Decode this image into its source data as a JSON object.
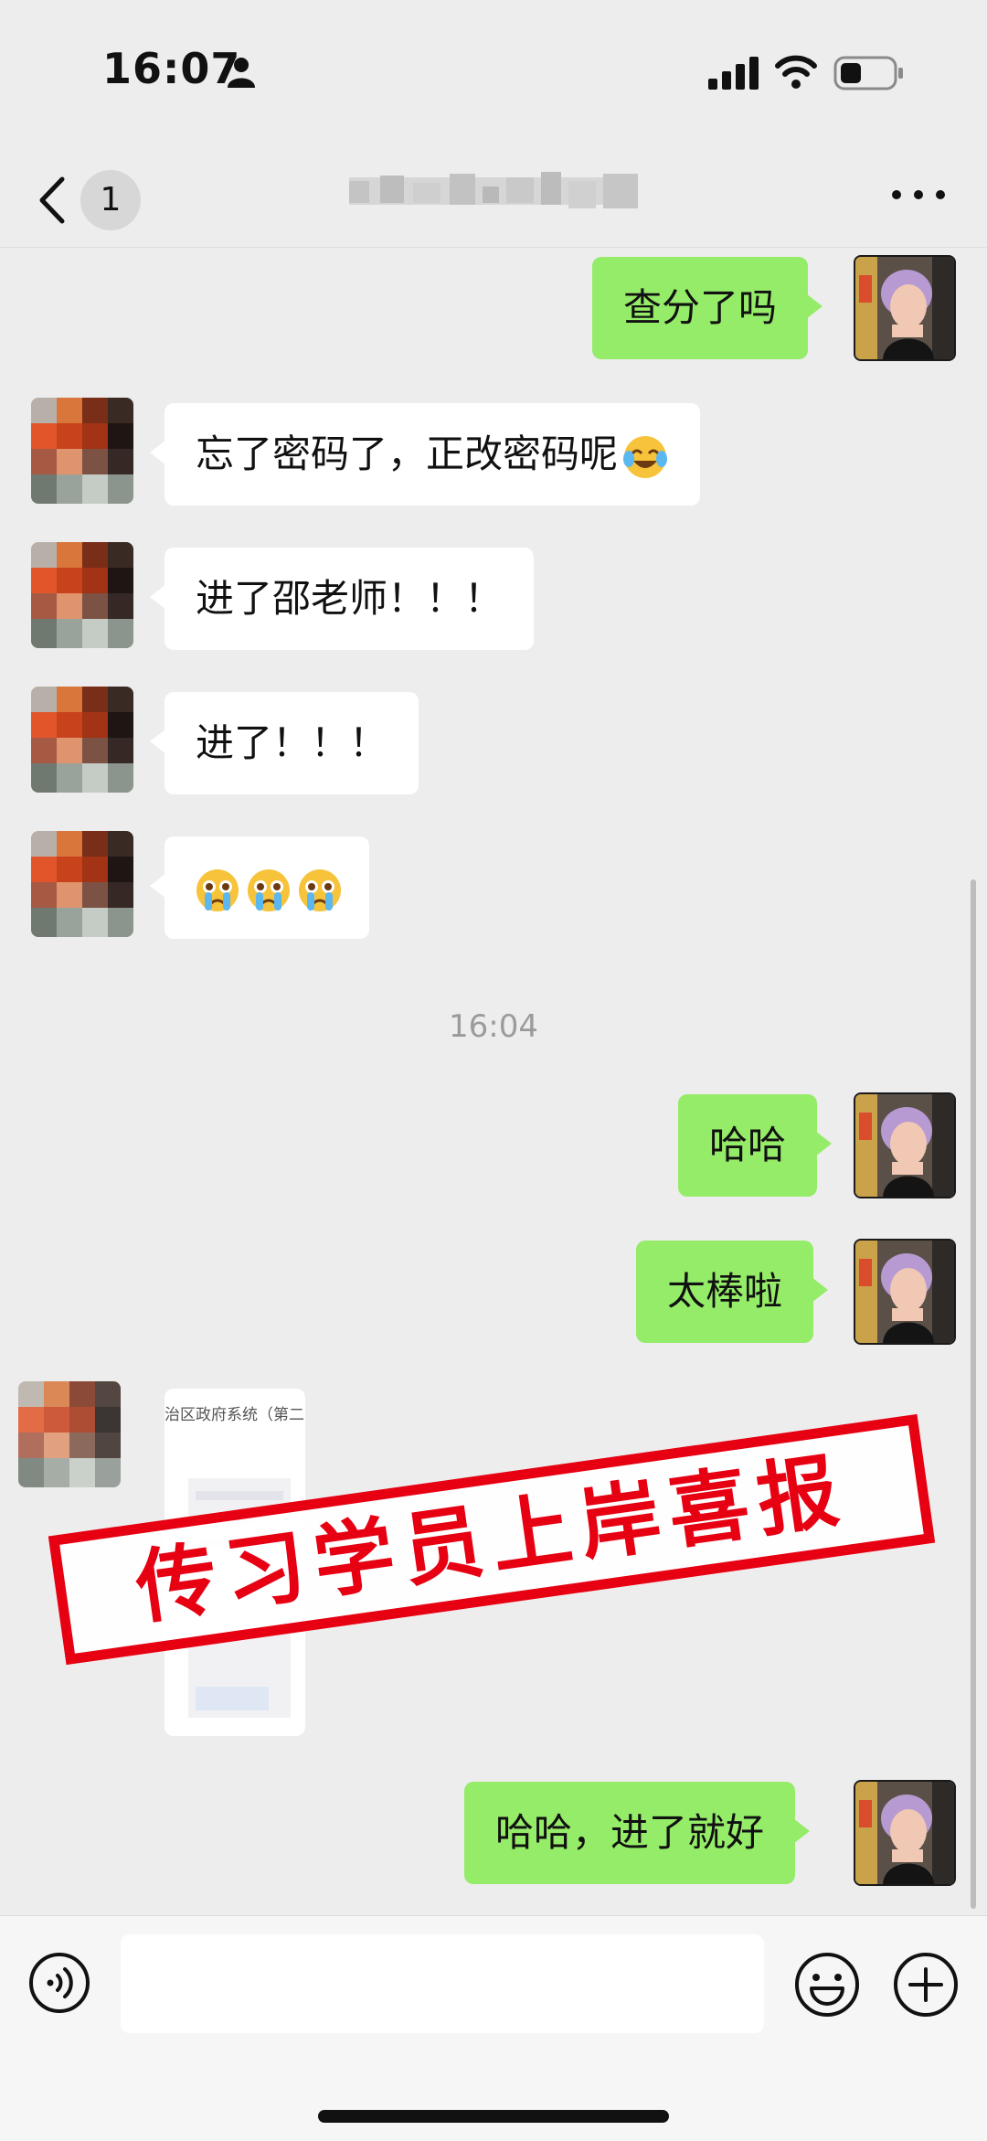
{
  "status_bar": {
    "time": "16:07"
  },
  "nav": {
    "unread_count": "1",
    "more_label": "···"
  },
  "messages": [
    {
      "side": "out",
      "text": "查分了吗"
    },
    {
      "side": "in",
      "text": "忘了密码了，正改密码呢",
      "emoji": "face-with-tears-of-joy"
    },
    {
      "side": "in",
      "text": "进了邵老师！！！"
    },
    {
      "side": "in",
      "text": "进了！！！"
    },
    {
      "side": "in",
      "emoji": "pleading-face-crying"
    },
    {
      "side": "out",
      "text": "哈哈"
    },
    {
      "side": "out",
      "text": "太棒啦"
    },
    {
      "side": "out",
      "text": "哈哈，进了就好"
    }
  ],
  "timestamp": "16:04",
  "file_card": {
    "title": "治区政府系统（第二"
  },
  "overlay_banner": "传习学员上岸喜报",
  "colors": {
    "outgoing_bubble": "#95ec69",
    "incoming_bubble": "#ffffff",
    "banner_red": "#e60012",
    "background": "#ededed"
  }
}
